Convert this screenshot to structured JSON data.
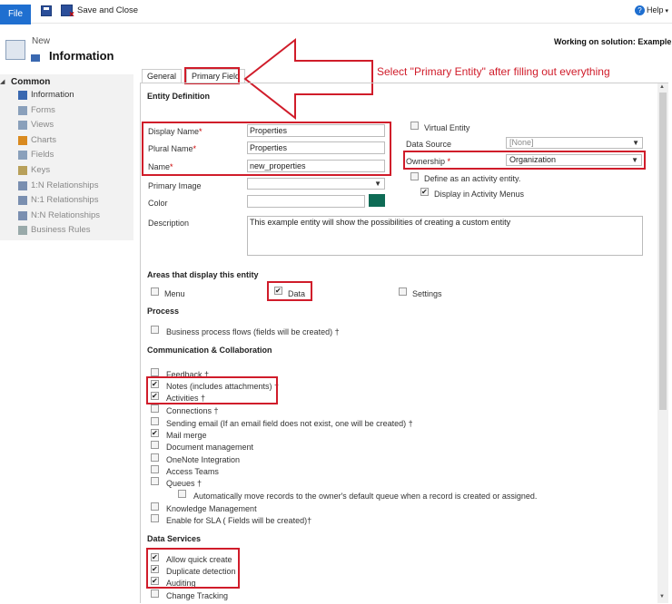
{
  "ribbon": {
    "file_label": "File",
    "save_close_label": "Save and Close",
    "help_label": "Help"
  },
  "header": {
    "breadcrumb": "New",
    "title": "Information",
    "solution_text": "Working on solution: Example"
  },
  "sidebar": {
    "group_label": "Common",
    "items": [
      {
        "label": "Information",
        "icon": "info-icon"
      },
      {
        "label": "Forms",
        "icon": "form-icon"
      },
      {
        "label": "Views",
        "icon": "view-icon"
      },
      {
        "label": "Charts",
        "icon": "chart-icon"
      },
      {
        "label": "Fields",
        "icon": "field-icon"
      },
      {
        "label": "Keys",
        "icon": "key-icon"
      },
      {
        "label": "1:N Relationships",
        "icon": "relationship-icon"
      },
      {
        "label": "N:1 Relationships",
        "icon": "relationship-icon"
      },
      {
        "label": "N:N Relationships",
        "icon": "relationship-icon"
      },
      {
        "label": "Business Rules",
        "icon": "rules-icon"
      }
    ]
  },
  "tabs": [
    {
      "label": "General"
    },
    {
      "label": "Primary Field"
    }
  ],
  "annotation": "Select \"Primary Entity\" after filling out everything",
  "entity_definition": {
    "section_title": "Entity Definition",
    "display_name_label": "Display Name",
    "display_name_value": "Properties",
    "plural_name_label": "Plural Name",
    "plural_name_value": "Properties",
    "name_label": "Name",
    "name_value": "new_properties",
    "primary_image_label": "Primary Image",
    "primary_image_value": "",
    "color_label": "Color",
    "color_swatch": "#0e6b55",
    "description_label": "Description",
    "description_value": "This example entity will show the possibilities of creating a custom entity",
    "virtual_entity_label": "Virtual Entity",
    "data_source_label": "Data Source",
    "data_source_value": "[None]",
    "ownership_label": "Ownership",
    "ownership_value": "Organization",
    "activity_entity_label": "Define as an activity entity.",
    "activity_menus_label": "Display in Activity Menus"
  },
  "areas": {
    "section_title": "Areas that display this entity",
    "menu_label": "Menu",
    "data_label": "Data",
    "settings_label": "Settings"
  },
  "process": {
    "section_title": "Process",
    "bpf_label": "Business process flows (fields will be created) †"
  },
  "communication": {
    "section_title": "Communication & Collaboration",
    "items": [
      {
        "label": "Feedback †",
        "checked": false
      },
      {
        "label": "Notes (includes attachments) †",
        "checked": true
      },
      {
        "label": "Activities †",
        "checked": true
      },
      {
        "label": "Connections †",
        "checked": false
      },
      {
        "label": "Sending email (If an email field does not exist, one will be created) †",
        "checked": false
      },
      {
        "label": "Mail merge",
        "checked": true
      },
      {
        "label": "Document management",
        "checked": false
      },
      {
        "label": "OneNote Integration",
        "checked": false
      },
      {
        "label": "Access Teams",
        "checked": false
      },
      {
        "label": "Queues †",
        "checked": false
      },
      {
        "label": "Automatically move records to the owner's default queue when a record is created or assigned.",
        "checked": false
      },
      {
        "label": "Knowledge Management",
        "checked": false
      },
      {
        "label": "Enable for SLA ( Fields will be created)†",
        "checked": false
      }
    ]
  },
  "data_services": {
    "section_title": "Data Services",
    "items": [
      {
        "label": "Allow quick create",
        "checked": true
      },
      {
        "label": "Duplicate detection",
        "checked": true
      },
      {
        "label": "Auditing",
        "checked": true
      },
      {
        "label": "Change Tracking",
        "checked": false
      }
    ]
  },
  "colors": {
    "annotation_red": "#d01c2a",
    "file_blue": "#1f6fd0"
  }
}
